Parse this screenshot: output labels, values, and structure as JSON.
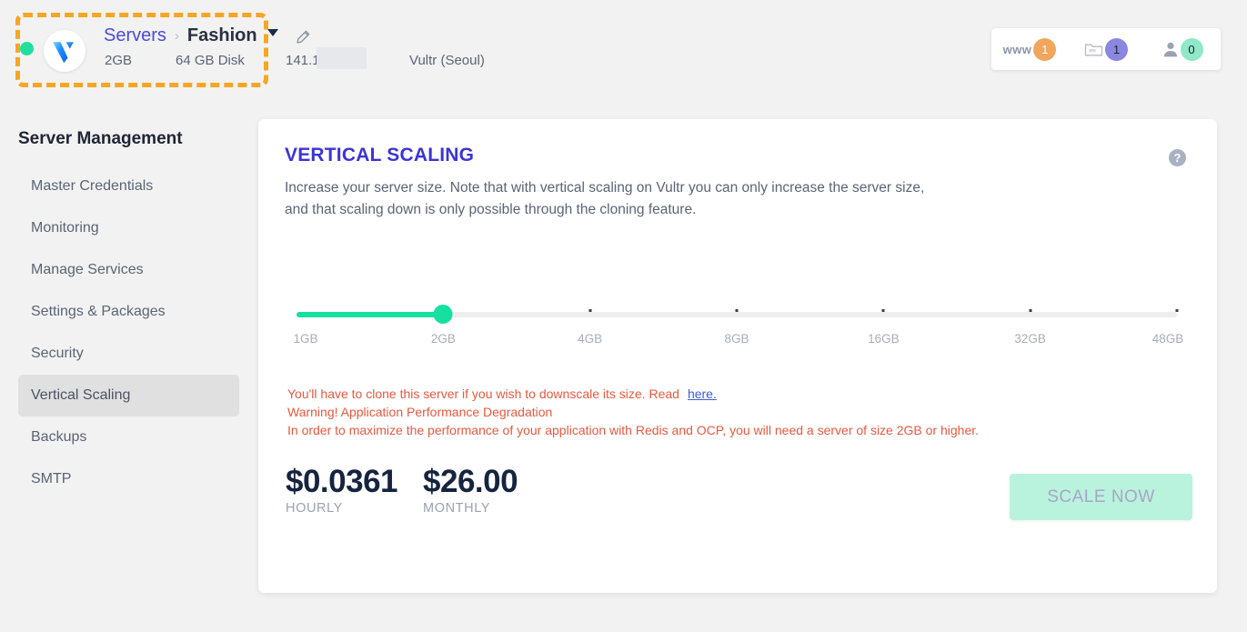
{
  "topbar": {
    "status": "online",
    "logo_icon": "vultr-logo-icon",
    "breadcrumb": {
      "root": "Servers",
      "separator": "›",
      "current": "Fashion"
    },
    "specs": {
      "ram": "2GB",
      "disk": "64 GB Disk"
    },
    "edit_icon": "pencil-icon",
    "ip_address": "141.1",
    "region": "Vultr (Seoul)",
    "badges": [
      {
        "label": "www",
        "icon": "www-icon",
        "count": "1",
        "color": "#f0a65c"
      },
      {
        "label": "",
        "icon": "folder-icon",
        "count": "1",
        "color": "#8a87e0"
      },
      {
        "label": "",
        "icon": "user-icon",
        "count": "0",
        "color": "#8fe8c6"
      }
    ]
  },
  "sidebar": {
    "title": "Server Management",
    "items": [
      {
        "label": "Master Credentials",
        "active": false
      },
      {
        "label": "Monitoring",
        "active": false
      },
      {
        "label": "Manage Services",
        "active": false
      },
      {
        "label": "Settings & Packages",
        "active": false
      },
      {
        "label": "Security",
        "active": false
      },
      {
        "label": "Vertical Scaling",
        "active": true
      },
      {
        "label": "Backups",
        "active": false
      },
      {
        "label": "SMTP",
        "active": false
      }
    ]
  },
  "card": {
    "title": "VERTICAL SCALING",
    "help_icon": "question-mark-icon",
    "description": "Increase your server size. Note that with vertical scaling on Vultr you can only increase the server size, and that scaling down is only possible through the cloning feature.",
    "slider": {
      "ticks": [
        "1GB",
        "2GB",
        "4GB",
        "8GB",
        "16GB",
        "32GB",
        "48GB"
      ],
      "selected_index": 1,
      "selected_value": "2GB",
      "fill_color": "#16e0a0",
      "track_color": "#eeeeee"
    },
    "warnings": {
      "line1": "You'll have to clone this server if you wish to downscale its size. Read",
      "link": "here.",
      "line2": "Warning! Application Performance Degradation",
      "line3": "In order to maximize the performance of your application with Redis and OCP, you will need a server of size 2GB or higher.",
      "color": "#e8593f"
    },
    "pricing": [
      {
        "value": "$0.0361",
        "label": "HOURLY"
      },
      {
        "value": "$26.00",
        "label": "MONTHLY"
      }
    ],
    "action_button": {
      "label": "SCALE NOW",
      "disabled": true,
      "background": "#b9f2dd"
    }
  }
}
